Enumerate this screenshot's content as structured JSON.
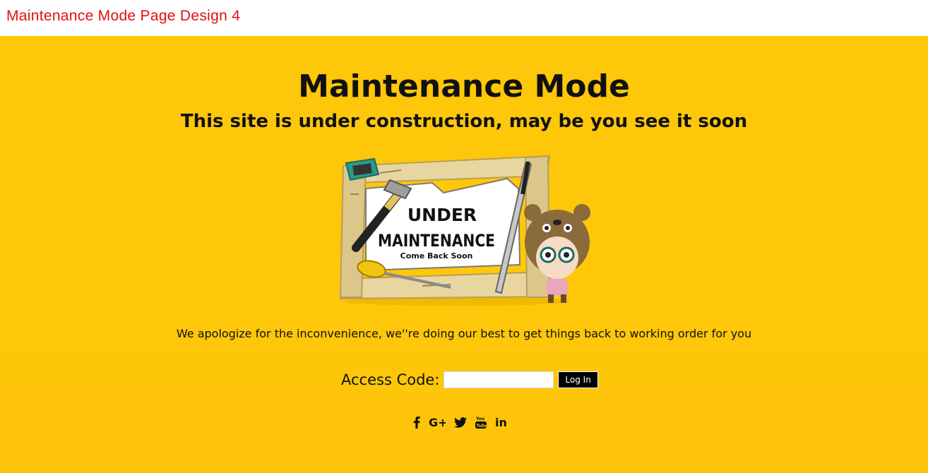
{
  "header": {
    "title": "Maintenance Mode Page Design 4"
  },
  "main": {
    "headline": "Maintenance Mode",
    "subheadline": "This site is under construction, may be you see it soon",
    "illustration": {
      "line1": "UNDER",
      "line2": "MAINTENANCE",
      "line3": "Come Back Soon"
    },
    "apology": "We apologize for the inconvenience, we''re doing our best to get things back to working order for you",
    "access": {
      "label": "Access Code:",
      "value": "",
      "placeholder": "",
      "button_label": "Log In"
    },
    "social": [
      {
        "icon": "facebook-icon"
      },
      {
        "icon": "google-plus-icon",
        "text": "G+"
      },
      {
        "icon": "twitter-icon"
      },
      {
        "icon": "youtube-icon",
        "text": "You Tube"
      },
      {
        "icon": "linkedin-icon",
        "text": "in"
      }
    ]
  },
  "colors": {
    "background": "#fec709",
    "header_title": "#e01010",
    "text": "#111111",
    "button_bg": "#000000",
    "button_text": "#ffffff"
  }
}
